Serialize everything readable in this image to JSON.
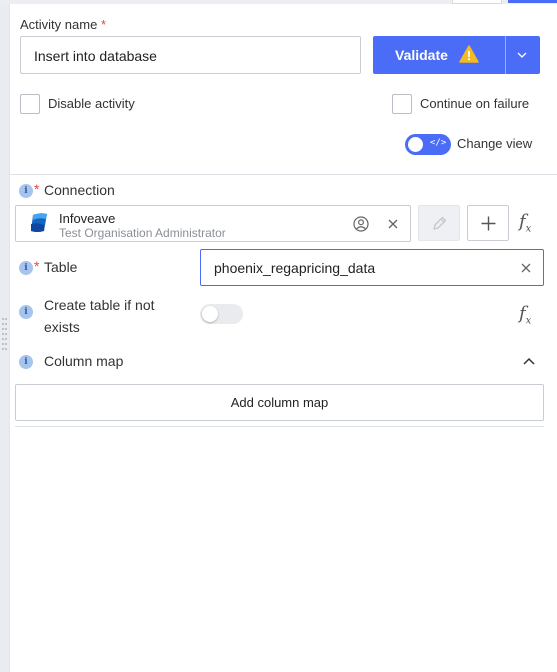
{
  "activity_name": {
    "label": "Activity name",
    "required_mark": "*",
    "value": "Insert into database"
  },
  "validate": {
    "label": "Validate",
    "warning_icon": "warning-triangle-icon",
    "dropdown_icon": "chevron-down-icon"
  },
  "options": {
    "disable_activity_label": "Disable activity",
    "continue_on_failure_label": "Continue on failure",
    "change_view_label": "Change view",
    "change_view_icon_text": "</>"
  },
  "connection": {
    "label": "Connection",
    "required_mark": "*",
    "name": "Infoveave",
    "subtitle": "Test Organisation Administrator"
  },
  "table": {
    "label": "Table",
    "required_mark": "*",
    "value": "phoenix_regapricing_data"
  },
  "create_table": {
    "label_line1": "Create table if not",
    "label_line2": "exists",
    "enabled": false
  },
  "column_map": {
    "label": "Column map",
    "add_label": "Add column map"
  },
  "info_glyph": "i",
  "fx": {
    "f": "f",
    "x": "x"
  },
  "colors": {
    "accent": "#4a6cf7",
    "required": "#e0454f",
    "info": "#a7c5ec",
    "warning": "#f5b921"
  }
}
